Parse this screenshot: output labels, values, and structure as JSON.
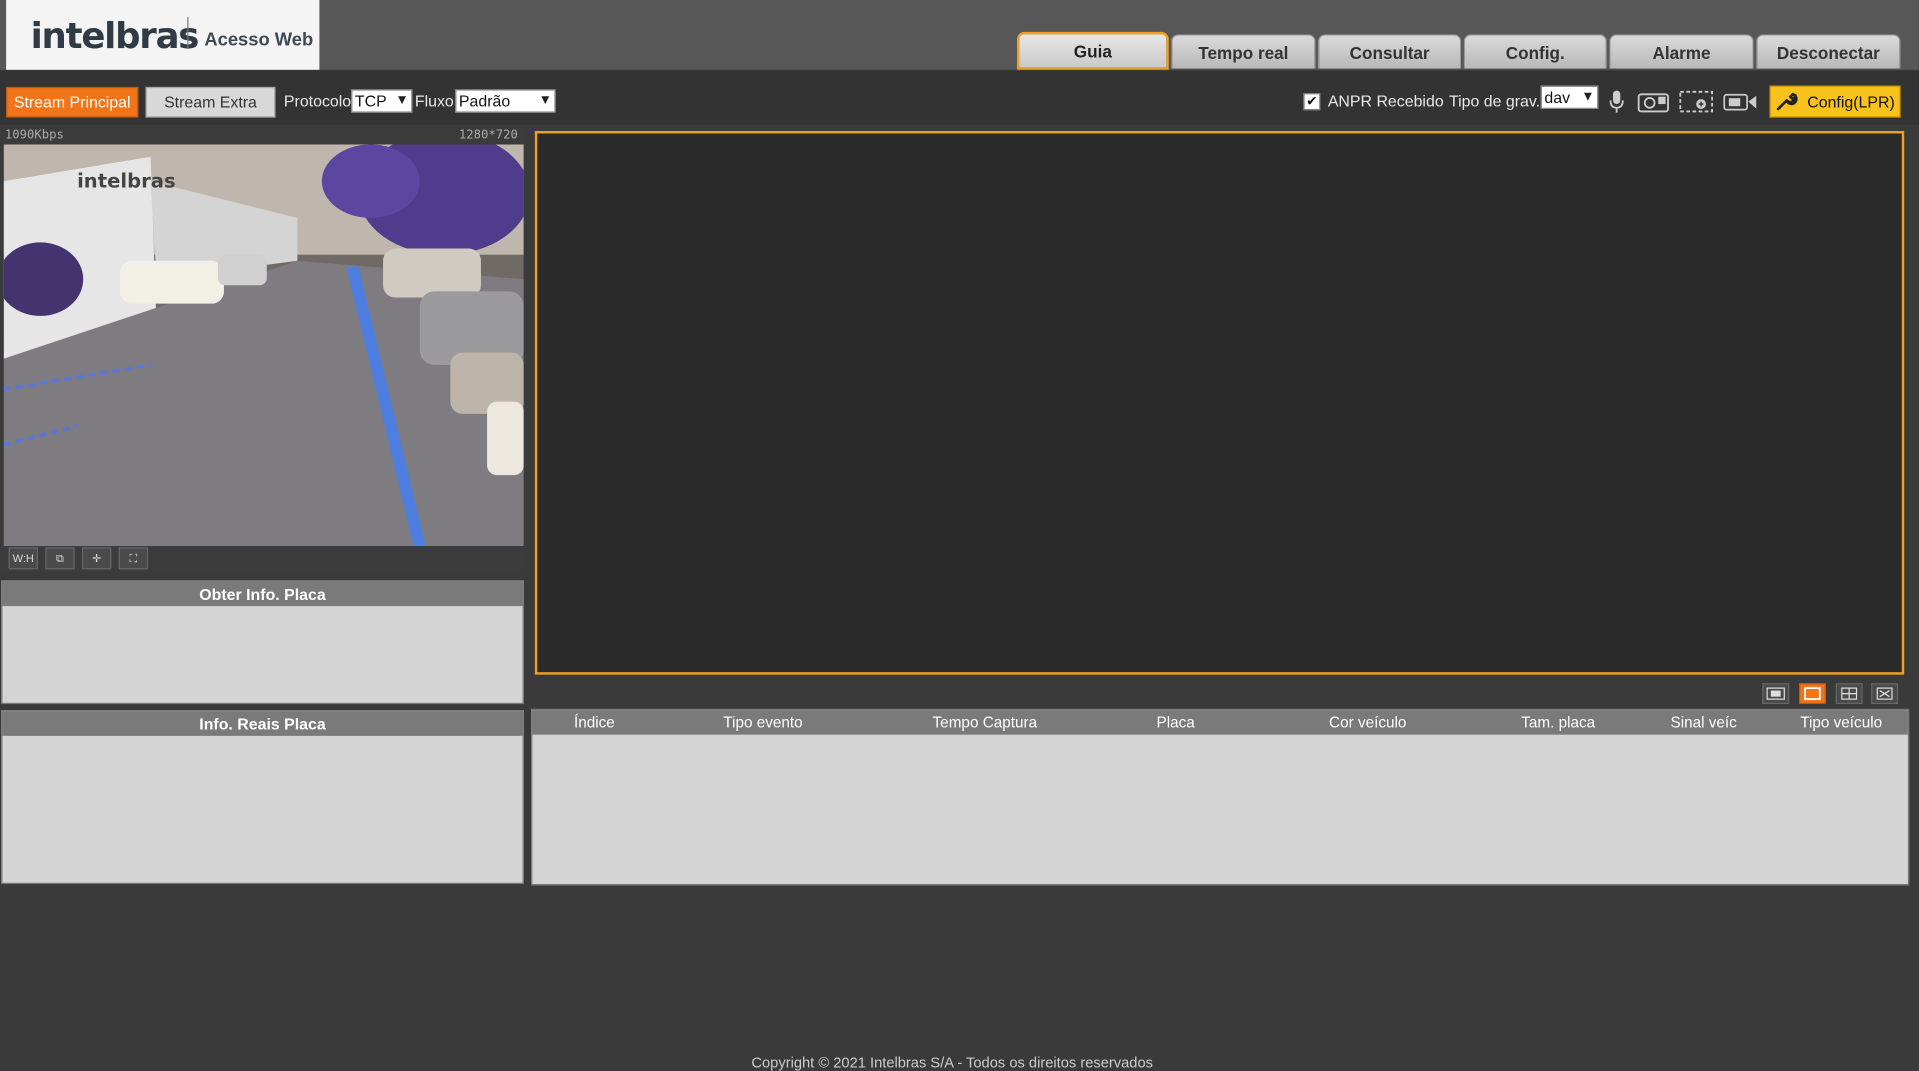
{
  "logo": {
    "brand": "intelbras",
    "subtitle": "Acesso Web"
  },
  "tabs": [
    {
      "label": "Guia",
      "active": true
    },
    {
      "label": "Tempo real"
    },
    {
      "label": "Consultar"
    },
    {
      "label": "Config."
    },
    {
      "label": "Alarme"
    },
    {
      "label": "Desconectar"
    }
  ],
  "toolbar": {
    "stream_main": "Stream Principal",
    "stream_extra": "Stream Extra",
    "protocol_label": "Protocolo",
    "protocol_value": "TCP",
    "flow_label": "Fluxo",
    "flow_value": "Padrão",
    "anpr_label": "ANPR Recebido",
    "anpr_checked": true,
    "rec_type_label": "Tipo de grav.",
    "rec_type_value": "dav",
    "config_lpr": "Config(LPR)"
  },
  "video": {
    "bitrate": "1090Kbps",
    "resolution": "1280*720",
    "controls": [
      "W:H",
      "⧉",
      "✛",
      "⛶"
    ]
  },
  "panels": {
    "plate_info": "Obter Info. Placa",
    "real_plate_info": "Info. Reais Placa"
  },
  "table": {
    "headers": [
      "Índice",
      "Tipo evento",
      "Tempo Captura",
      "Placa",
      "Cor veículo",
      "Tam. placa",
      "Sinal veíc",
      "Tipo veículo"
    ]
  },
  "footer": {
    "copyright": "Copyright © 2021 Intelbras S/A - Todos os direitos reservados"
  },
  "colors": {
    "accent_orange": "#f0741a",
    "highlight_yellow": "#f7c21b",
    "frame_border": "#f0a020"
  }
}
